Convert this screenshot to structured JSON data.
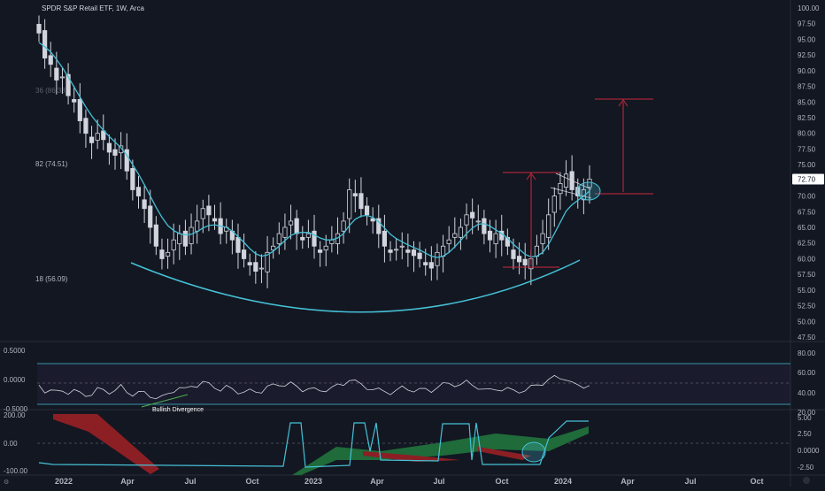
{
  "header": {
    "symbol_title": "SPDR S&P Retail ETF, 1W, Arca"
  },
  "chart_data": [
    {
      "type": "candlestick",
      "panel": "price",
      "yticks": [
        "100.00",
        "97.50",
        "95.00",
        "92.50",
        "90.00",
        "87.50",
        "85.00",
        "82.50",
        "80.00",
        "77.50",
        "75.00",
        "72.50",
        "70.00",
        "67.50",
        "65.00",
        "62.50",
        "60.00",
        "57.50",
        "55.00",
        "52.50",
        "50.00",
        "47.50"
      ],
      "ylim": [
        46.5,
        101.5
      ],
      "last_price": "72.70",
      "left_labels": [
        "36 (86.38)",
        "82 (74.51)",
        "18 (56.09)"
      ],
      "close": [
        96.0,
        92.0,
        91.0,
        88.5,
        89.0,
        86.0,
        85.0,
        82.0,
        80.0,
        78.5,
        80.0,
        79.0,
        77.0,
        76.5,
        78.0,
        74.0,
        71.0,
        70.0,
        68.0,
        65.0,
        62.0,
        60.0,
        61.0,
        63.0,
        64.0,
        62.0,
        65.0,
        66.0,
        68.0,
        67.0,
        66.0,
        64.0,
        65.0,
        63.0,
        61.0,
        60.0,
        59.0,
        58.0,
        58.5,
        61.0,
        62.0,
        64.0,
        65.0,
        66.0,
        64.0,
        63.0,
        64.0,
        62.0,
        61.0,
        62.0,
        63.0,
        64.0,
        66.0,
        71.0,
        70.0,
        68.0,
        67.0,
        66.0,
        64.0,
        62.0,
        61.0,
        61.5,
        62.0,
        61.0,
        60.5,
        60.0,
        59.0,
        58.5,
        61.0,
        62.0,
        63.0,
        64.0,
        65.0,
        67.0,
        66.5,
        66.0,
        64.0,
        63.0,
        64.0,
        63.0,
        62.0,
        60.0,
        59.5,
        59.0,
        60.0,
        62.0,
        64.0,
        67.0,
        70.0,
        72.0,
        73.5,
        71.0,
        70.0,
        71.0,
        72.7
      ],
      "sma": [
        94.5,
        93.8,
        93.0,
        91.8,
        90.5,
        89.0,
        87.4,
        85.8,
        84.2,
        82.8,
        81.6,
        80.5,
        79.5,
        78.6,
        77.7,
        76.5,
        75.0,
        73.5,
        71.8,
        70.0,
        68.2,
        66.6,
        65.3,
        64.5,
        64.0,
        63.8,
        63.9,
        64.3,
        64.9,
        65.3,
        65.4,
        65.2,
        65.0,
        64.4,
        63.5,
        62.6,
        61.6,
        60.8,
        60.4,
        60.6,
        61.2,
        62.0,
        62.9,
        63.7,
        64.1,
        64.2,
        64.2,
        63.8,
        63.3,
        63.0,
        63.0,
        63.3,
        64.0,
        65.3,
        66.3,
        66.8,
        66.9,
        66.6,
        65.9,
        64.9,
        63.9,
        63.2,
        62.7,
        62.2,
        61.8,
        61.4,
        60.9,
        60.4,
        60.2,
        60.4,
        61.0,
        61.9,
        62.9,
        64.0,
        64.9,
        65.5,
        65.6,
        65.2,
        64.6,
        64.0,
        63.3,
        62.3,
        61.5,
        60.7,
        60.3,
        60.4,
        61.0,
        62.3,
        64.0,
        65.8,
        67.6,
        68.6,
        69.3,
        70.0,
        70.8
      ]
    },
    {
      "type": "line",
      "panel": "oscillator",
      "yticks_left": [
        "0.5000",
        "0.0000",
        "-0.5000"
      ],
      "yticks_right": [
        "80.00",
        "60.00",
        "40.00",
        "20.00"
      ],
      "annotation": "Bullish Divergence"
    },
    {
      "type": "area",
      "panel": "momentum",
      "yticks_left": [
        "200.00",
        "0.00",
        "-100.00"
      ],
      "yticks_right": [
        "5.00",
        "2.50",
        "0.0000",
        "-2.50"
      ]
    }
  ],
  "x_axis": {
    "ticks": [
      "2022",
      "Apr",
      "Jul",
      "Oct",
      "2023",
      "Apr",
      "Jul",
      "Oct",
      "2024",
      "Apr",
      "Jul",
      "Oct"
    ]
  },
  "colors": {
    "bg": "#131722",
    "candle": "#d1d4dc",
    "sma": "#45c1d6",
    "curve": "#45c1d6",
    "target": "#c8283c",
    "green_band": "#1f6b3a",
    "red_band": "#8c1f24"
  }
}
